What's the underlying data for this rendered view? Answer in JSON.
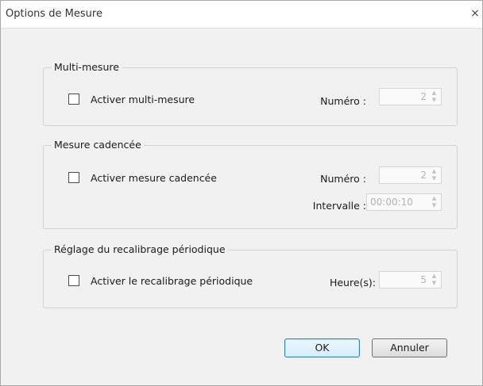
{
  "window": {
    "title": "Options de Mesure",
    "close_glyph": "×"
  },
  "multi": {
    "legend": "Multi-mesure",
    "checkbox_label": "Activer multi-mesure",
    "checked": false,
    "number_label": "Numéro :",
    "number_value": "2"
  },
  "timed": {
    "legend": "Mesure cadencée",
    "checkbox_label": "Activer mesure cadencée",
    "checked": false,
    "number_label": "Numéro :",
    "number_value": "2",
    "interval_label": "Intervalle :",
    "interval_value": "00:00:10"
  },
  "recal": {
    "legend": "Réglage du recalibrage périodique",
    "checkbox_label": "Activer le recalibrage périodique",
    "checked": false,
    "hours_label": "Heure(s):",
    "hours_value": "5"
  },
  "buttons": {
    "ok_label": "OK",
    "cancel_label": "Annuler"
  },
  "icons": {
    "close": "close-icon",
    "spin_up": "chevron-up-icon",
    "spin_down": "chevron-down-icon"
  }
}
